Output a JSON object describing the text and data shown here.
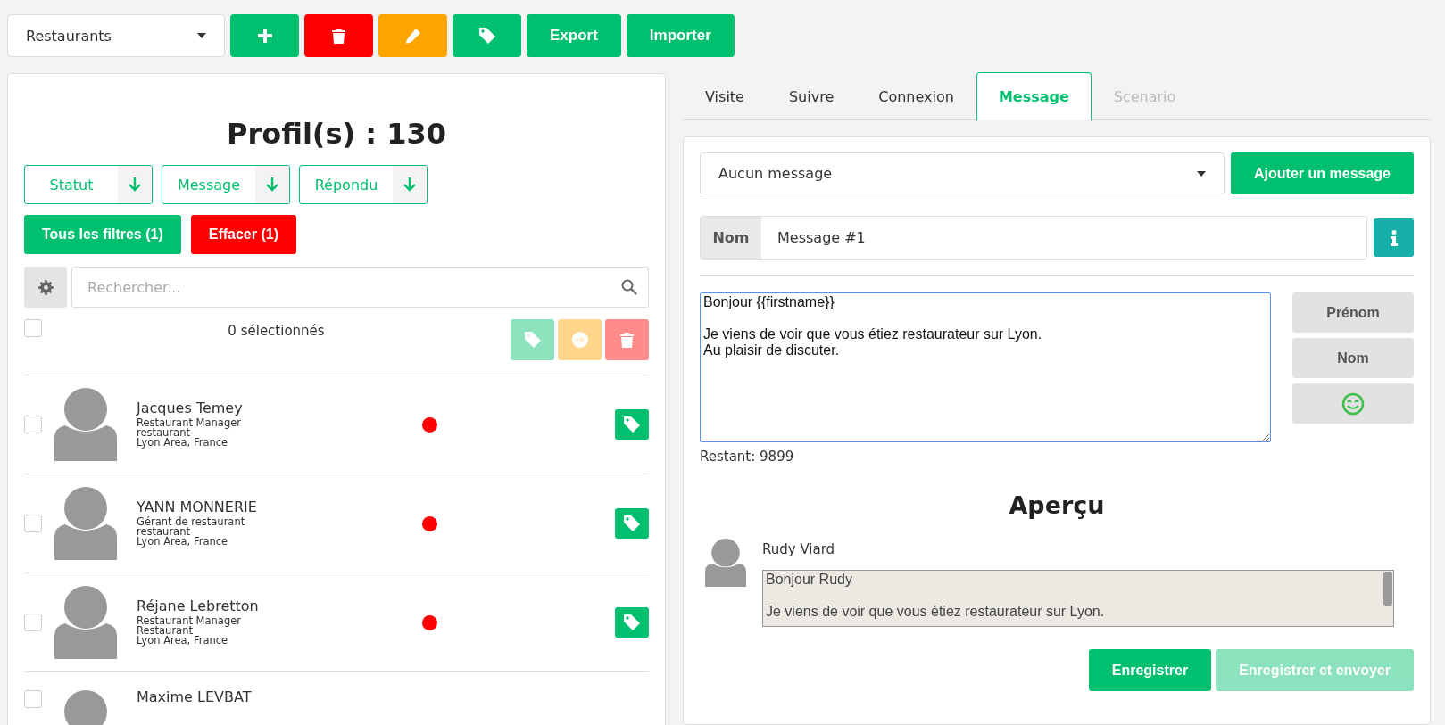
{
  "toolbar": {
    "list_select": "Restaurants",
    "buttons": [
      {
        "kind": "add"
      },
      {
        "kind": "delete"
      },
      {
        "kind": "edit"
      },
      {
        "kind": "tag"
      },
      {
        "kind": "text",
        "label": "Export"
      },
      {
        "kind": "text",
        "label": "Importer"
      }
    ]
  },
  "profiles": {
    "title": "Profil(s) : 130",
    "filters": [
      {
        "label": "Statut"
      },
      {
        "label": "Message"
      },
      {
        "label": "Répondu"
      }
    ],
    "filter_actions": [
      {
        "kind": "primary",
        "label": "Tous les filtres (1)"
      },
      {
        "kind": "danger",
        "label": "Effacer (1)"
      }
    ],
    "search": {
      "placeholder": "Rechercher..."
    },
    "selection": {
      "checked": false,
      "count": "0 sélectionnés",
      "actions": [
        {
          "kind": "tag",
          "disabled": true
        },
        {
          "kind": "move",
          "disabled": true
        },
        {
          "kind": "delete",
          "disabled": true
        }
      ]
    },
    "rows": [
      {
        "name": "Jacques Temey",
        "title": "Restaurant Manager",
        "company": "restaurant",
        "location": "Lyon Area, France",
        "checked": false,
        "color": "#ff0000"
      },
      {
        "name": "YANN MONNERIE",
        "title": "Gérant de restaurant",
        "company": "restaurant",
        "location": "Lyon Area, France",
        "checked": false,
        "color": "#ff0000"
      },
      {
        "name": "Réjane Lebretton",
        "title": "Restaurant Manager",
        "company": "Restaurant",
        "location": "Lyon Area, France",
        "checked": false,
        "color": "#ff0000"
      },
      {
        "name": "Maxime LEVBAT",
        "checked": false
      }
    ]
  },
  "message": {
    "tabs": [
      {
        "label": "Visite",
        "selected": false,
        "disabled": false
      },
      {
        "label": "Suivre",
        "selected": false,
        "disabled": false
      },
      {
        "label": "Connexion",
        "selected": false,
        "disabled": false
      },
      {
        "label": "Message",
        "selected": true,
        "disabled": false
      },
      {
        "label": "Scenario",
        "selected": false,
        "disabled": true
      }
    ],
    "message_select": "Aucun message",
    "add_button": "Ajouter un message",
    "name_field": {
      "label": "Nom",
      "value": "Message #1"
    },
    "body": "Bonjour {{firstname}}\n\nJe viens de voir que vous étiez restaurateur sur Lyon.\nAu plaisir de discuter.",
    "insert_buttons": [
      {
        "kind": "text",
        "label": "Prénom"
      },
      {
        "kind": "text",
        "label": "Nom"
      },
      {
        "kind": "emoji"
      }
    ],
    "remaining": "Restant: 9899",
    "preview": {
      "title": "Aperçu",
      "sender": "Rudy Viard",
      "text": "Bonjour Rudy\n\nJe viens de voir que vous étiez restaurateur sur Lyon."
    },
    "actions": [
      {
        "label": "Enregistrer",
        "disabled": false
      },
      {
        "label": "Enregistrer et envoyer",
        "disabled": true
      }
    ]
  }
}
